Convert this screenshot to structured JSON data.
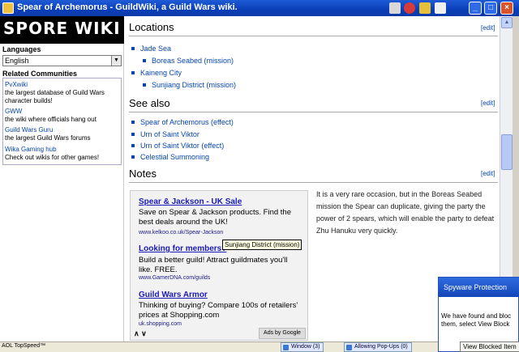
{
  "window": {
    "title": "Spear of Archemorus - GuildWiki, a Guild Wars wiki."
  },
  "sidebar": {
    "logo_text": "SPORE WIKI",
    "languages_heading": "Languages",
    "language_selected": "English",
    "related_heading": "Related Communities",
    "communities": [
      {
        "name": "PvXwiki",
        "desc": "the largest database of Guild Wars character builds!"
      },
      {
        "name": "GWW",
        "desc": "the wiki where officials hang out"
      },
      {
        "name": "Guild Wars Guru",
        "desc": "the largest Guild Wars forums"
      },
      {
        "name": "Wika Gaming hub",
        "desc": "Check out wikis for other games!"
      }
    ]
  },
  "main": {
    "edit_label": "[edit]",
    "locations": {
      "heading": "Locations",
      "items": [
        "Jade Sea",
        "Boreas Seabed (mission)",
        "Kaineng City",
        "Sunjiang District (mission)"
      ]
    },
    "see_also": {
      "heading": "See also",
      "items": [
        "Spear of Archemorus (effect)",
        "Urn of Saint Viktor",
        "Urn of Saint Viktor (effect)",
        "Celestial Summoning"
      ]
    },
    "notes": {
      "heading": "Notes",
      "text": "It is a very rare occasion, but in the Boreas Seabed mission the Spear can duplicate, giving the party the power of 2 spears, which will enable the party to defeat Zhu Hanuku very quickly."
    }
  },
  "ads": {
    "items": [
      {
        "title": "Spear & Jackson - UK Sale",
        "desc": "Save on Spear & Jackson products. Find the best deals around the UK!",
        "url": "www.kelkoo.co.uk/Spear-Jackson"
      },
      {
        "title": "Looking for members?",
        "desc": "Build a better guild! Attract guildmates you'll like. FREE.",
        "url": "www.GamerDNA.com/guilds"
      },
      {
        "title": "Guild Wars Armor",
        "desc": "Thinking of buying? Compare 100s of retailers' prices at Shopping.com",
        "url": "uk.shopping.com"
      }
    ],
    "nav": "∧ ∨",
    "ads_by": "Ads by Google",
    "tooltip": "Sunjiang District (mission)"
  },
  "statusbar": {
    "left": "AOL TopSpeed™",
    "window_btn": "Window (3)",
    "popups_btn": "Allowing Pop-Ups (0)"
  },
  "popup": {
    "title": "Spyware Protection",
    "body_line1": "We have found and bloc",
    "body_line2": "them, select View Block",
    "button": "View Blocked Item"
  }
}
